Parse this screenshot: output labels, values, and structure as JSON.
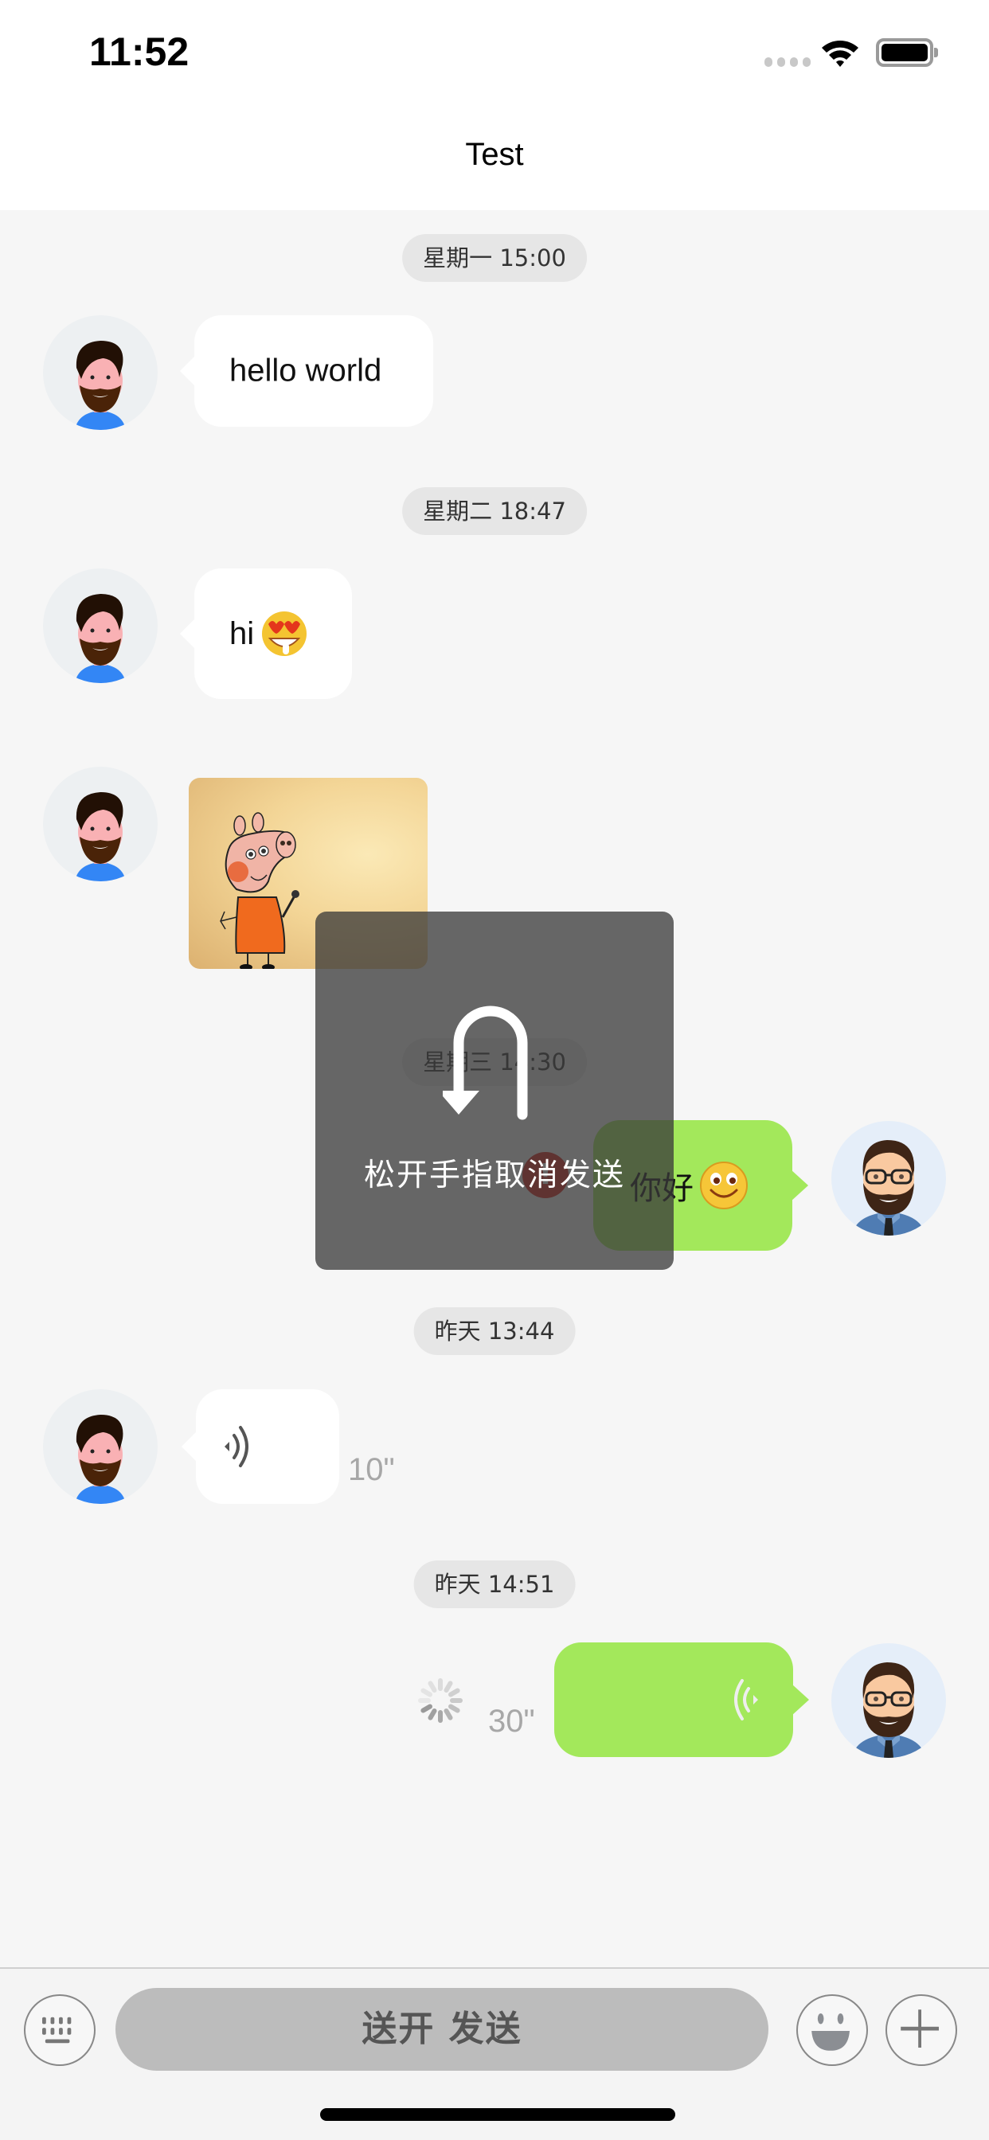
{
  "status_bar": {
    "time": "11:52",
    "signal_icon": "cellular-signal-icon",
    "wifi_icon": "wifi-icon",
    "battery_icon": "battery-icon"
  },
  "nav": {
    "title": "Test"
  },
  "timestamps": [
    "星期一 15:00",
    "星期二 18:47",
    "星期三 14:30",
    "昨天 13:44",
    "昨天 14:51"
  ],
  "messages": [
    {
      "sender": "them",
      "type": "text",
      "text": "hello world"
    },
    {
      "sender": "them",
      "type": "text",
      "text": "hi",
      "emoji": "heart-eyes-drooling-emoji"
    },
    {
      "sender": "them",
      "type": "image",
      "description": "Peppa Pig drawing"
    },
    {
      "sender": "me",
      "type": "text",
      "text": "你好",
      "emoji": "smile-emoji",
      "status": "failed",
      "status_text": "!"
    },
    {
      "sender": "them",
      "type": "voice",
      "duration": "10\""
    },
    {
      "sender": "me",
      "type": "voice",
      "duration": "30\"",
      "status": "sending"
    }
  ],
  "recording_hud": {
    "icon": "cancel-return-arrow-icon",
    "text": "松开手指取消发送"
  },
  "input_bar": {
    "keyboard_icon": "keyboard-icon",
    "talk_button_label": "送开 发送",
    "emoji_icon": "emoji-face-icon",
    "plus_icon": "plus-icon"
  },
  "colors": {
    "bubble_me": "#a3e85b",
    "bubble_them": "#ffffff",
    "background": "#f6f6f6",
    "error": "#d9231a"
  }
}
